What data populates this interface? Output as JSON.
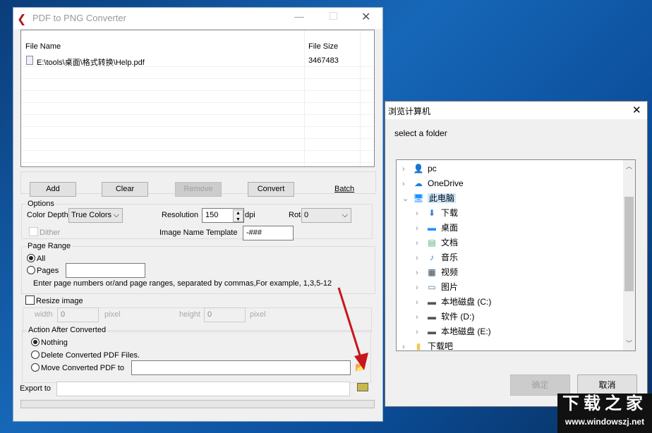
{
  "main_window": {
    "title": "PDF to PNG Converter",
    "file_list": {
      "headers": [
        "File Name",
        "File Size"
      ],
      "rows": [
        {
          "name": "E:\\tools\\桌面\\格式转换\\Help.pdf",
          "size": "3467483"
        }
      ]
    },
    "buttons": {
      "add": "Add",
      "clear": "Clear",
      "remove": "Remove",
      "convert": "Convert",
      "batch": "Batch"
    },
    "options": {
      "legend": "Options",
      "color_depth_label": "Color Depth",
      "color_depth_value": "True Colors",
      "resolution_label": "Resolution",
      "resolution_value": "150",
      "dpi": "dpi",
      "rotate_label": "Rotate",
      "rotate_value": "0",
      "dither_label": "Dither",
      "template_label": "Image Name Template",
      "template_value": "-###"
    },
    "page_range": {
      "legend": "Page Range",
      "all": "All",
      "pages": "Pages",
      "pages_value": "",
      "hint": "Enter page numbers or/and page ranges, separated by commas,For example, 1,3,5-12"
    },
    "resize": {
      "label": "Resize image",
      "width_label": "width",
      "width_value": "0",
      "height_label": "height",
      "height_value": "0",
      "unit": "pixel"
    },
    "action": {
      "legend": "Action After Converted",
      "nothing": "Nothing",
      "delete": "Delete Converted PDF Files.",
      "move": "Move Converted PDF to",
      "move_value": ""
    },
    "export": {
      "label": "Export to",
      "value": ""
    }
  },
  "dialog": {
    "title": "浏览计算机",
    "prompt": "select a folder",
    "tree": [
      {
        "label": "pc",
        "icon": "user-icon",
        "level": 0
      },
      {
        "label": "OneDrive",
        "icon": "cloud-icon",
        "level": 0
      },
      {
        "label": "此电脑",
        "icon": "computer-icon",
        "level": 0,
        "expanded": true,
        "selected": true
      },
      {
        "label": "下载",
        "icon": "download-icon",
        "level": 1
      },
      {
        "label": "桌面",
        "icon": "desktop-icon",
        "level": 1
      },
      {
        "label": "文档",
        "icon": "document-icon",
        "level": 1
      },
      {
        "label": "音乐",
        "icon": "music-icon",
        "level": 1
      },
      {
        "label": "视频",
        "icon": "video-icon",
        "level": 1
      },
      {
        "label": "图片",
        "icon": "picture-icon",
        "level": 1
      },
      {
        "label": "本地磁盘 (C:)",
        "icon": "drive-icon",
        "level": 1
      },
      {
        "label": "软件 (D:)",
        "icon": "drive-icon",
        "level": 1
      },
      {
        "label": "本地磁盘 (E:)",
        "icon": "drive-icon",
        "level": 1
      },
      {
        "label": "下载吧",
        "icon": "folder-icon",
        "level": 0
      }
    ],
    "ok": "确定",
    "cancel": "取消"
  },
  "watermark": {
    "title": "下载之家",
    "url": "www.windowszj.net"
  }
}
